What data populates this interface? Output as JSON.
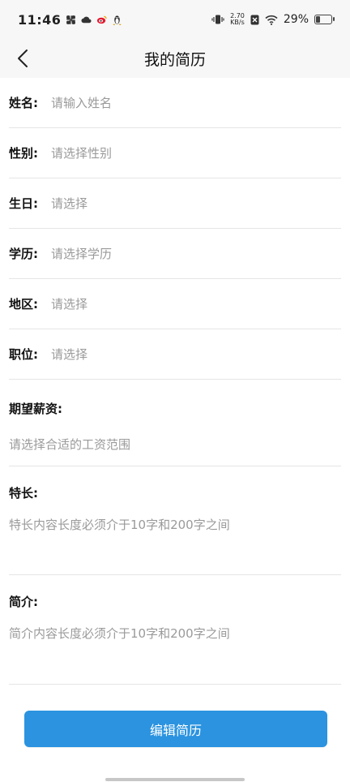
{
  "status_bar": {
    "time": "11:46",
    "net_speed_value": "2.70",
    "net_speed_unit": "KB/s",
    "battery_percent": "29%",
    "battery_level": 0.29
  },
  "nav": {
    "title": "我的简历"
  },
  "form": {
    "rows": [
      {
        "label": "姓名:",
        "placeholder": "请输入姓名"
      },
      {
        "label": "性别:",
        "placeholder": "请选择性别"
      },
      {
        "label": "生日:",
        "placeholder": "请选择"
      },
      {
        "label": "学历:",
        "placeholder": "请选择学历"
      },
      {
        "label": "地区:",
        "placeholder": "请选择"
      },
      {
        "label": "职位:",
        "placeholder": "请选择"
      }
    ],
    "salary": {
      "label": "期望薪资:",
      "placeholder": "请选择合适的工资范围"
    },
    "special": {
      "label": "特长:",
      "placeholder": "特长内容长度必须介于10字和200字之间"
    },
    "intro": {
      "label": "简介:",
      "placeholder": "简介内容长度必须介于10字和200字之间"
    }
  },
  "actions": {
    "edit_label": "编辑简历"
  },
  "colors": {
    "primary": "#2b93e0",
    "placeholder": "#9a9a9a",
    "divider": "#e5e5e5"
  }
}
